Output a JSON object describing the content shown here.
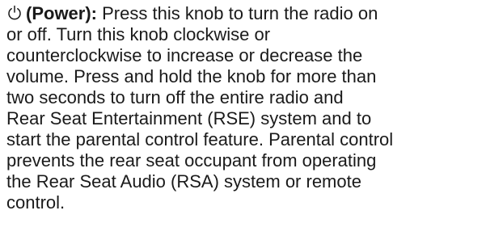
{
  "entry": {
    "icon": "power-icon",
    "term": "(Power):",
    "lines": [
      "Press this knob to turn the radio on",
      "or off. Turn this knob clockwise or",
      "counterclockwise to increase or decrease the",
      "volume. Press and hold the knob for more than",
      "two seconds to turn off the entire radio and",
      "Rear Seat Entertainment (RSE) system and to",
      "start the parental control feature. Parental control",
      "prevents the rear seat occupant from operating",
      "the Rear Seat Audio (RSA) system or remote",
      "control."
    ]
  }
}
